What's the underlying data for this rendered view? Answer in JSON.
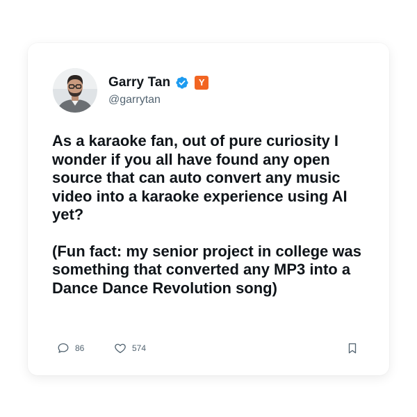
{
  "author": {
    "display_name": "Garry Tan",
    "handle": "@garrytan",
    "badge_letter": "Y",
    "badge_color": "#f26522",
    "verified_color": "#1d9bf0"
  },
  "tweet": {
    "paragraphs": [
      "As a karaoke fan, out of pure curiosity I wonder if you all have found any open source that can auto convert any music video into a karaoke experience using AI yet?",
      "(Fun fact: my senior project in college was something that converted any MP3 into a Dance Dance Revolution song)"
    ]
  },
  "actions": {
    "replies": "86",
    "likes": "574",
    "icons": [
      "comment-icon",
      "heart-icon",
      "bookmark-icon"
    ]
  }
}
